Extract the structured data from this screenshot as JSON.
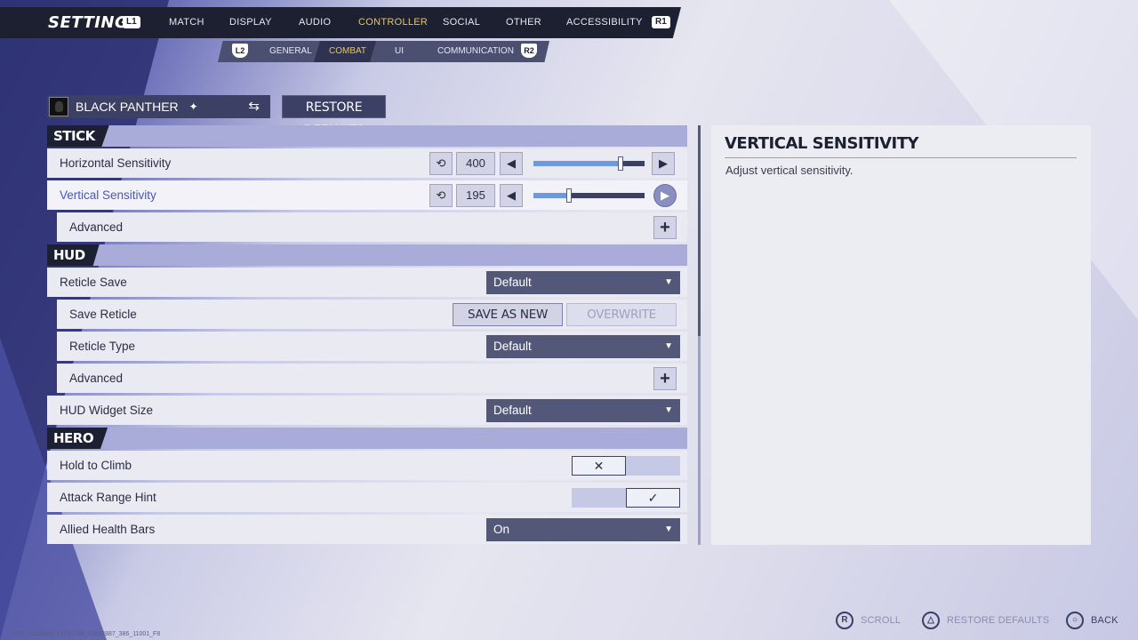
{
  "header": {
    "title": "SETTINGS",
    "left_bumper": "L1",
    "right_bumper": "R1",
    "tabs": [
      {
        "label": "MATCH",
        "active": false
      },
      {
        "label": "DISPLAY",
        "active": false
      },
      {
        "label": "AUDIO",
        "active": false
      },
      {
        "label": "CONTROLLER",
        "active": true
      },
      {
        "label": "SOCIAL",
        "active": false
      },
      {
        "label": "OTHER",
        "active": false
      },
      {
        "label": "ACCESSIBILITY",
        "active": false
      }
    ]
  },
  "subheader": {
    "left_trigger": "L2",
    "right_trigger": "R2",
    "tabs": [
      {
        "label": "GENERAL",
        "active": false
      },
      {
        "label": "COMBAT",
        "active": true
      },
      {
        "label": "UI",
        "active": false
      },
      {
        "label": "COMMUNICATION",
        "active": false
      }
    ]
  },
  "hero_selector": {
    "name": "BLACK PANTHER",
    "star_icon": "diamond-star-icon",
    "swap_icon": "swap-icon"
  },
  "restore_defaults_label": "RESTORE DEFAULTS",
  "sections": {
    "stick": {
      "label": "STICK",
      "horizontal": {
        "label": "Horizontal Sensitivity",
        "value": "400",
        "fill": 0.78
      },
      "vertical": {
        "label": "Vertical Sensitivity",
        "value": "195",
        "fill": 0.32
      },
      "advanced": {
        "label": "Advanced"
      }
    },
    "hud": {
      "label": "HUD",
      "reticle_save": {
        "label": "Reticle Save",
        "value": "Default"
      },
      "save_reticle": {
        "label": "Save Reticle",
        "save_as_new": "SAVE AS NEW",
        "overwrite": "OVERWRITE"
      },
      "reticle_type": {
        "label": "Reticle Type",
        "value": "Default"
      },
      "advanced": {
        "label": "Advanced"
      },
      "widget_size": {
        "label": "HUD Widget Size",
        "value": "Default"
      }
    },
    "hero": {
      "label": "HERO",
      "hold_to_climb": {
        "label": "Hold to Climb",
        "state": "off",
        "glyph": "✕"
      },
      "attack_range_hint": {
        "label": "Attack Range Hint",
        "state": "on",
        "glyph": "✓"
      },
      "allied_health_bars": {
        "label": "Allied Health Bars",
        "value": "On"
      }
    }
  },
  "description": {
    "title": "VERTICAL SENSITIVITY",
    "text": "Adjust vertical sensitivity."
  },
  "footer": {
    "scroll": {
      "glyph": "R",
      "label": "SCROLL"
    },
    "restore": {
      "glyph": "△",
      "label": "RESTORE DEFAULTS"
    },
    "back": {
      "glyph": "○",
      "label": "BACK"
    },
    "version": "PS5: 11552888 | 5781788_14502887_386_11001_F8"
  },
  "colors": {
    "accent_active": "#e2c46a",
    "dark_bar": "#1d2030",
    "slider_fill": "#6e99e0",
    "focused_label": "#4a57b5"
  }
}
